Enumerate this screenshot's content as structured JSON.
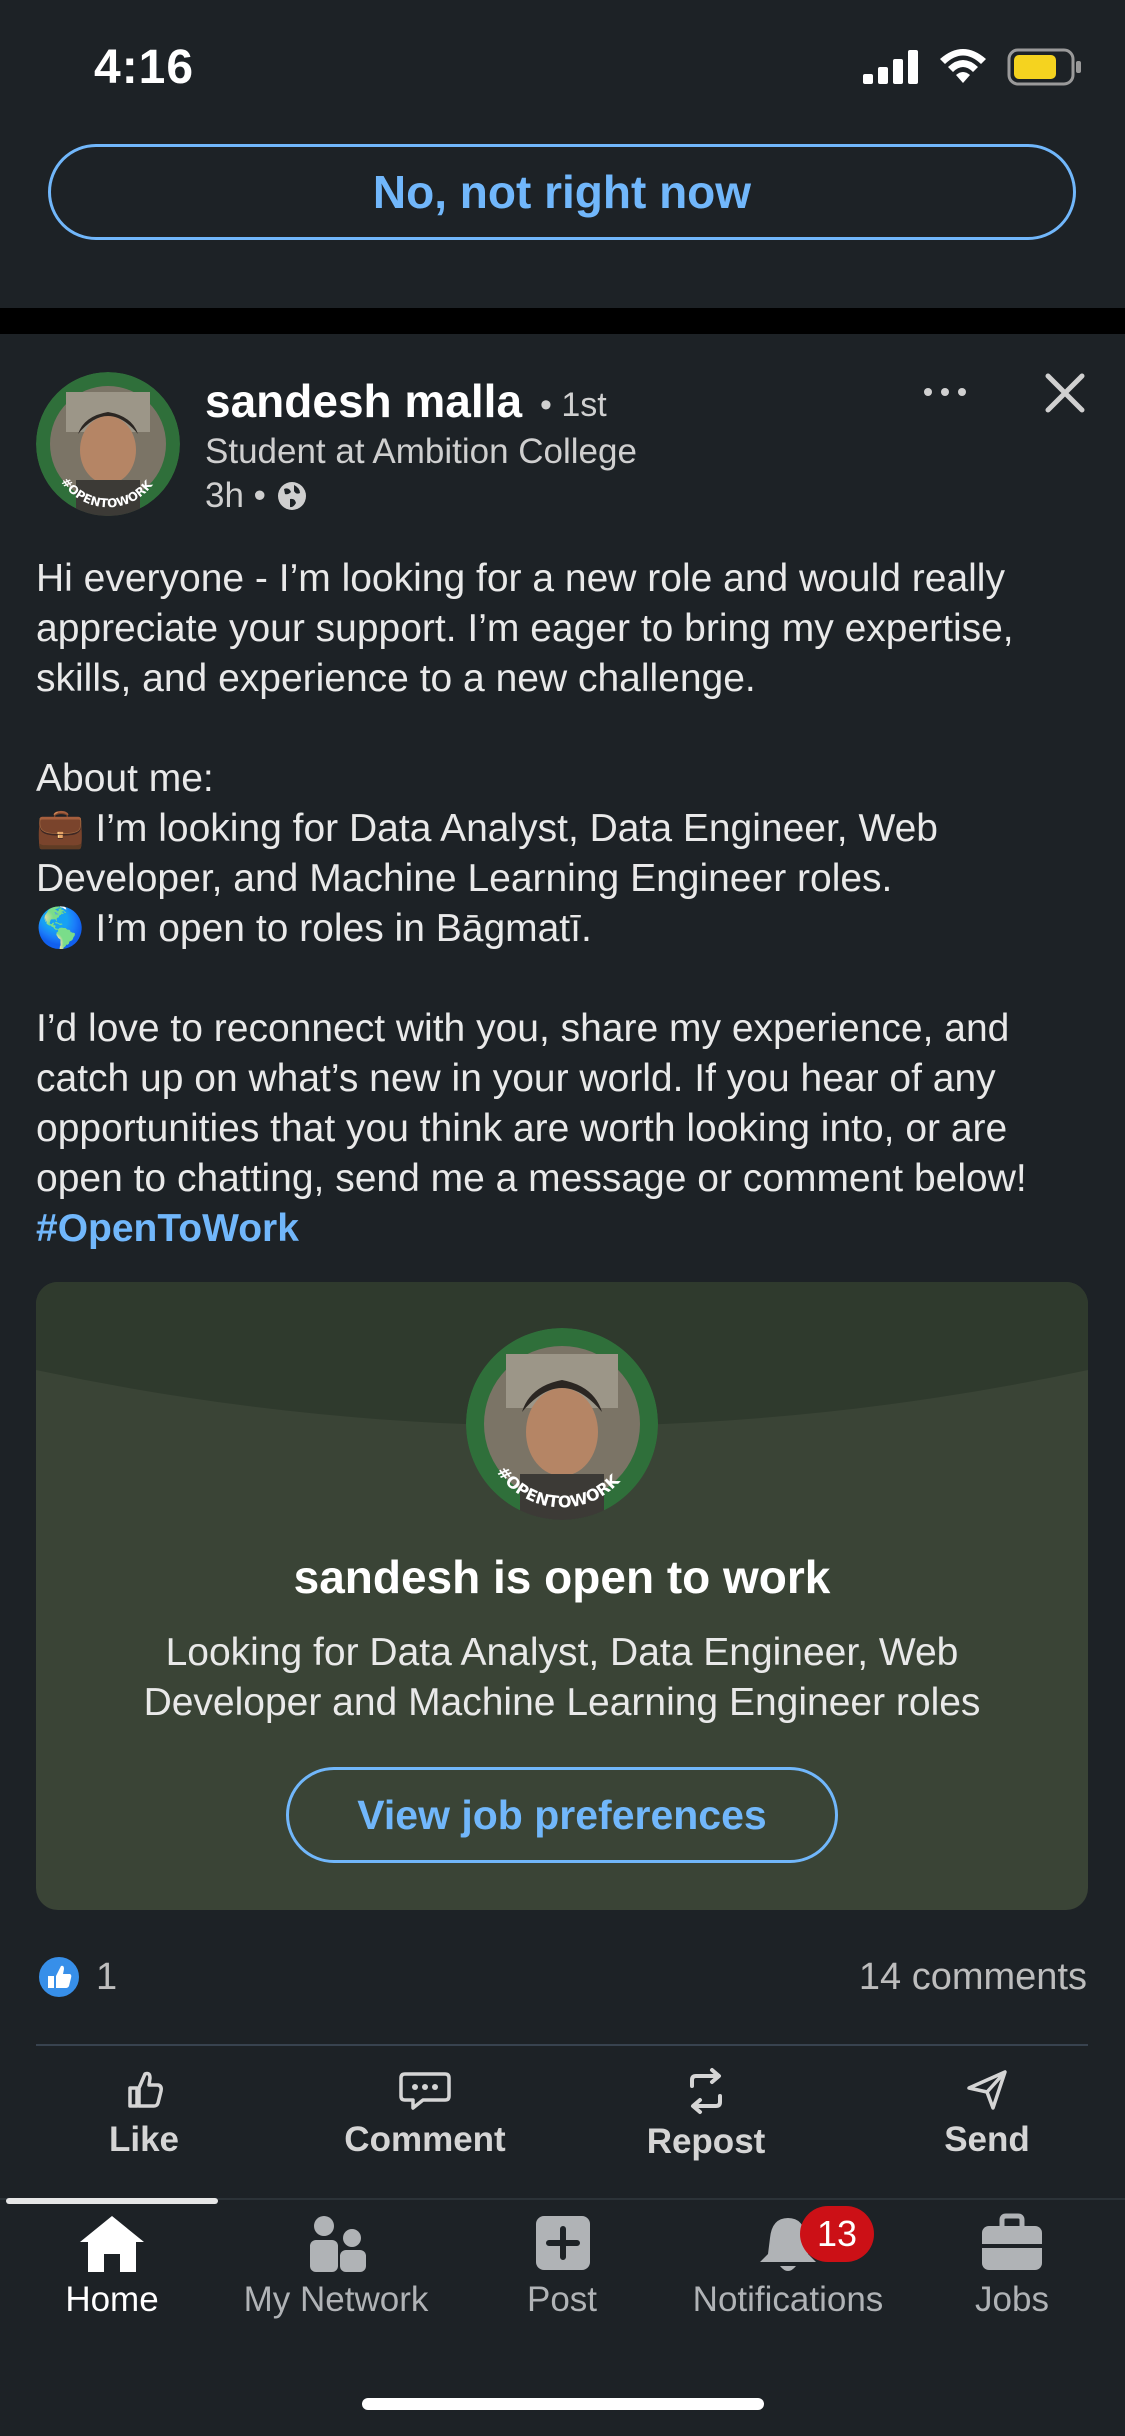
{
  "status_bar": {
    "time": "4:16"
  },
  "prompt": {
    "dismiss_label": "No, not right now"
  },
  "post": {
    "author_name": "sandesh malla",
    "degree": "• 1st",
    "headline": "Student at Ambition College",
    "time_ago": "3h •",
    "body": {
      "intro": "Hi everyone - I’m looking for a new role and would really appreciate your support. I’m eager to bring my expertise, skills, and experience to a new challenge.",
      "about_heading": "About me:",
      "roles_emoji": "💼",
      "roles_line": "I’m looking for Data Analyst, Data Engineer, Web Developer, and Machine Learning Engineer roles.",
      "location_emoji": "🌎",
      "location_line": "I’m open to roles in Bāgmatī.",
      "closing": "I’d love to reconnect with you, share my experience, and catch up on what’s new in your world. If you hear of any opportunities that you think are worth looking into, or are open to chatting, send me a message or comment below!",
      "hashtag": "#OpenToWork"
    },
    "avatar_ring_text": "#OPENTOWORK"
  },
  "open_to_work_card": {
    "title": "sandesh is open to work",
    "description": "Looking for Data Analyst, Data Engineer, Web Developer and Machine Learning Engineer roles",
    "button_label": "View job preferences"
  },
  "social": {
    "reaction_count": "1",
    "comments_label": "14 comments"
  },
  "actions": [
    {
      "label": "Like",
      "icon": "like-icon"
    },
    {
      "label": "Comment",
      "icon": "comment-icon"
    },
    {
      "label": "Repost",
      "icon": "repost-icon"
    },
    {
      "label": "Send",
      "icon": "send-icon"
    }
  ],
  "nav": [
    {
      "label": "Home",
      "icon": "home-icon",
      "active": true
    },
    {
      "label": "My Network",
      "icon": "network-icon"
    },
    {
      "label": "Post",
      "icon": "post-icon"
    },
    {
      "label": "Notifications",
      "icon": "bell-icon",
      "badge": "13"
    },
    {
      "label": "Jobs",
      "icon": "briefcase-icon"
    }
  ],
  "colors": {
    "background": "#1d2226",
    "accent_blue": "#71b7fb",
    "card_green": "#3a4436",
    "badge_red": "#cc1016",
    "battery_yellow": "#f5d31f"
  }
}
